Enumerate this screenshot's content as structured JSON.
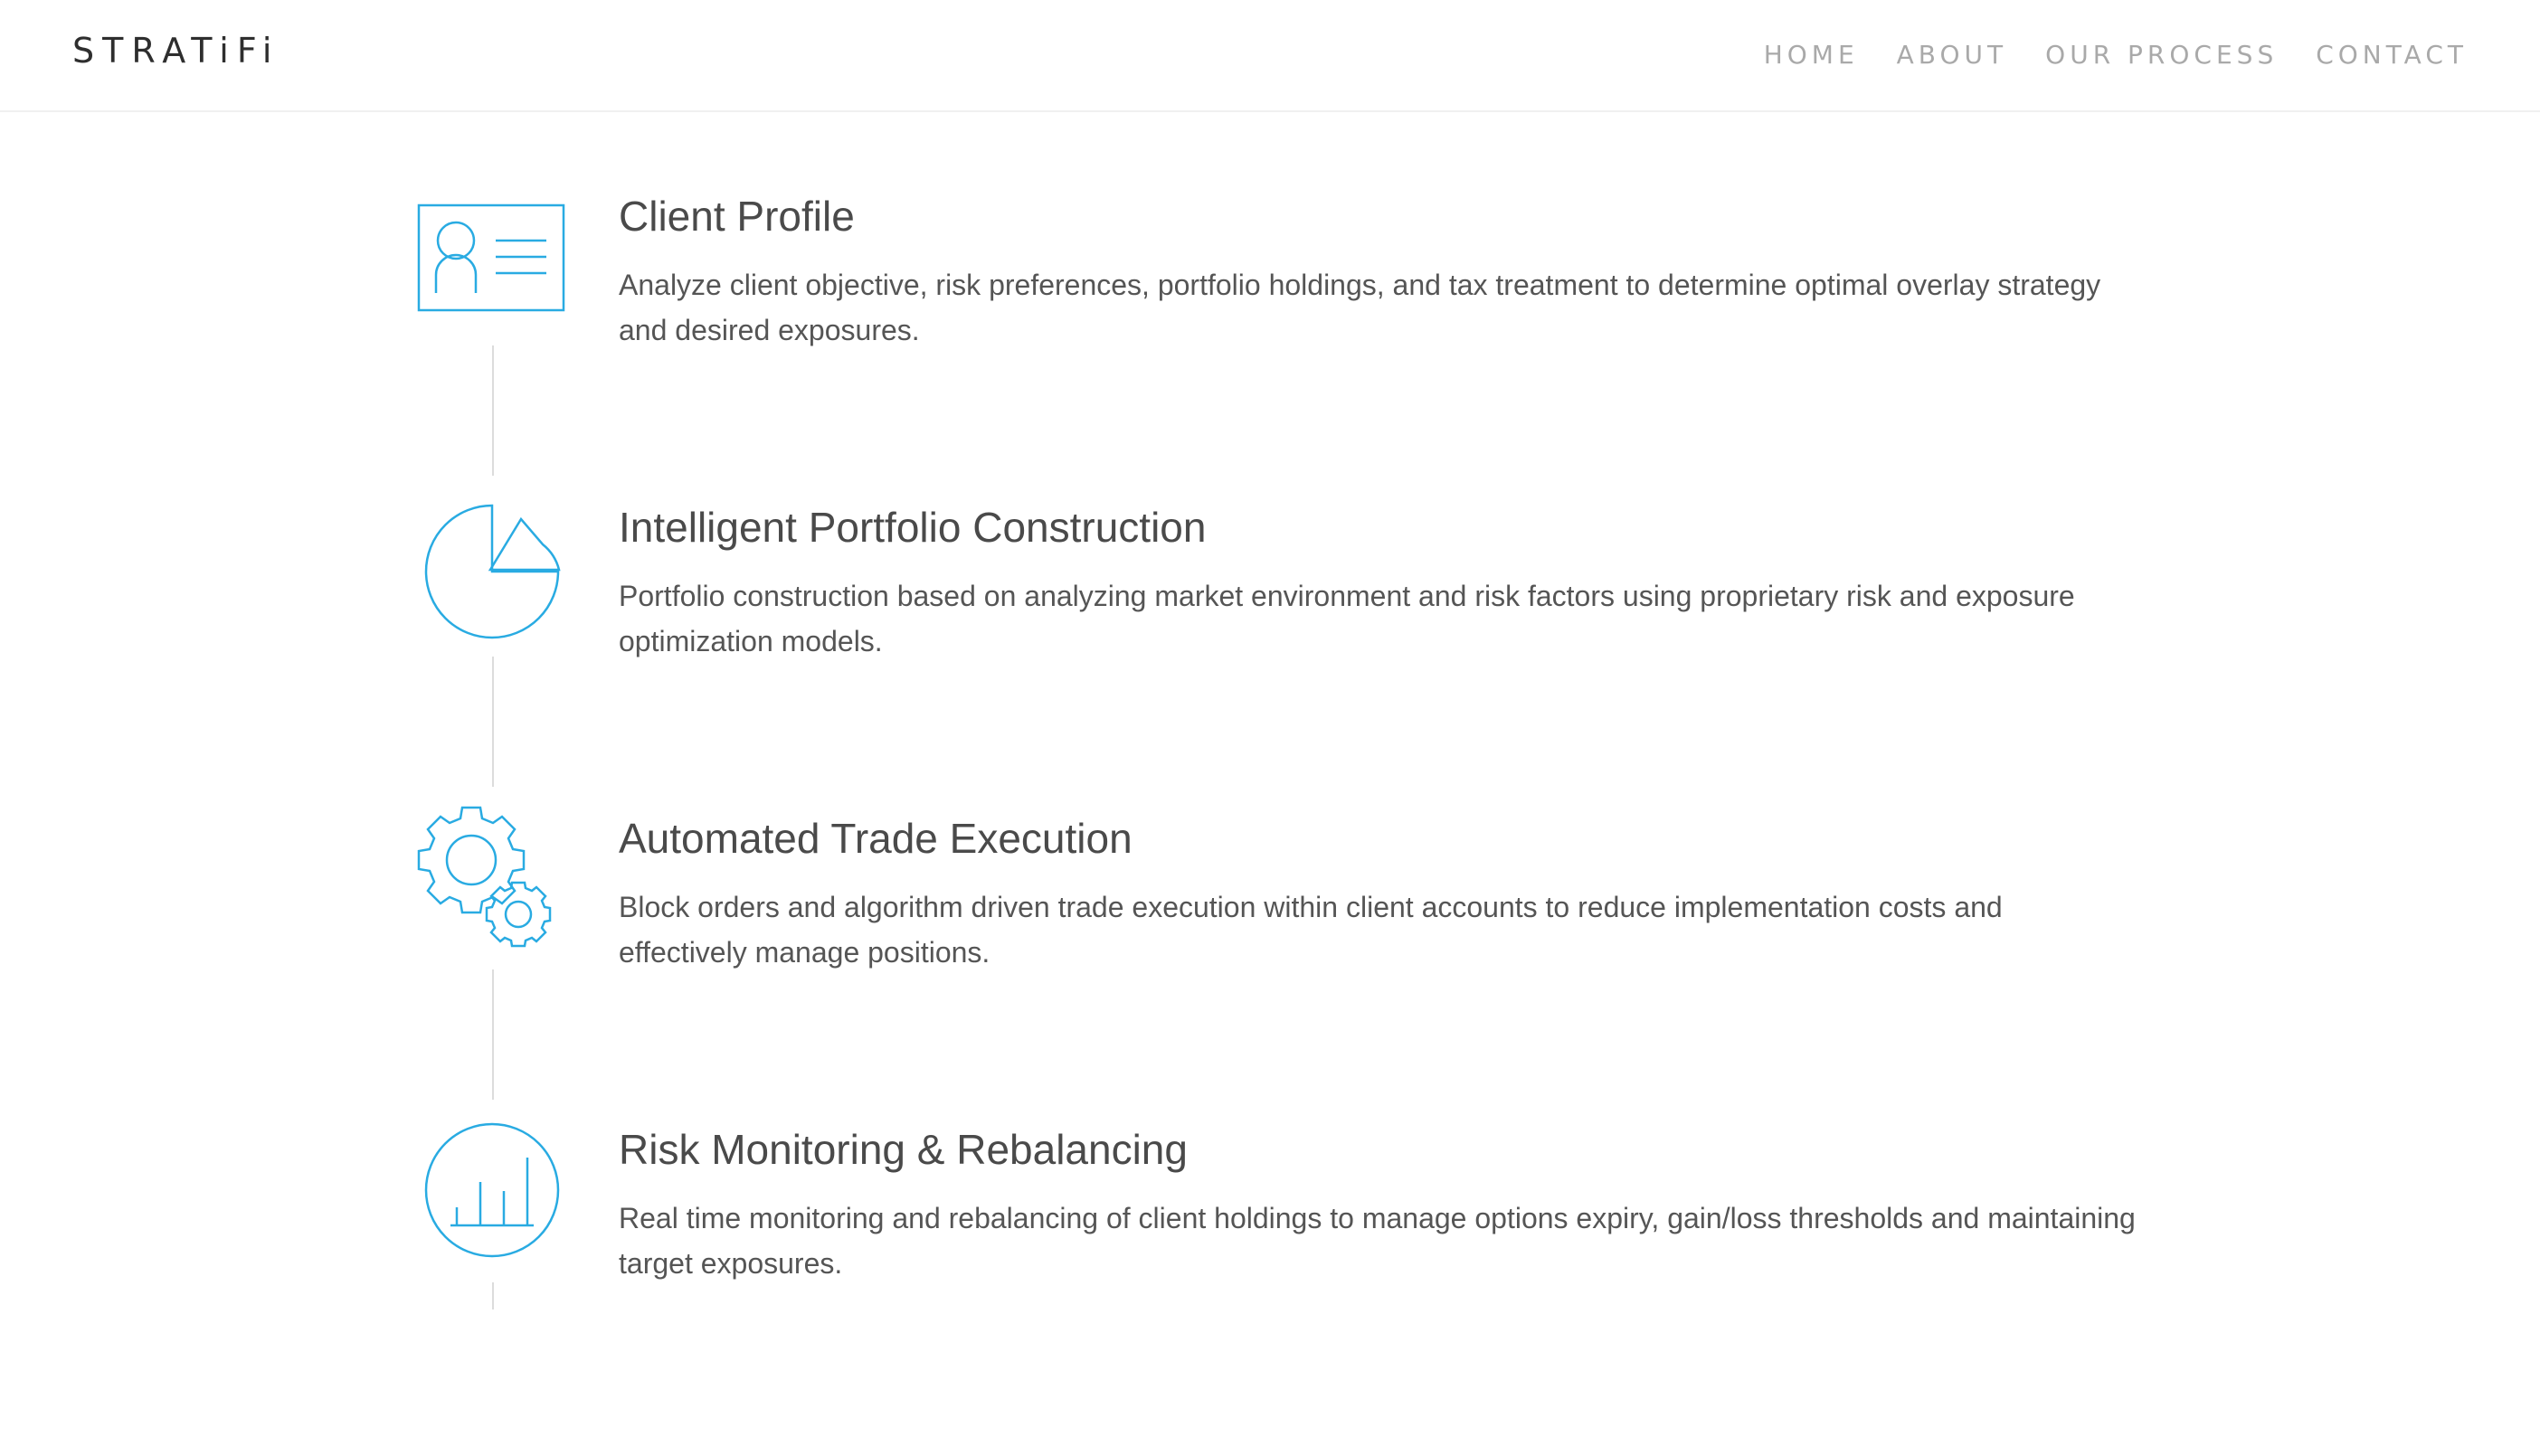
{
  "brand": {
    "logo": "STRATiFi"
  },
  "nav": {
    "items": [
      {
        "label": "HOME"
      },
      {
        "label": "ABOUT"
      },
      {
        "label": "OUR PROCESS"
      },
      {
        "label": "CONTACT"
      }
    ]
  },
  "colors": {
    "accent": "#29abe2",
    "text": "#4a4a4a",
    "nav": "#a9a9a9",
    "connector": "#dcdcdc"
  },
  "steps": [
    {
      "icon": "client-profile-card-icon",
      "title": "Client Profile",
      "description": "Analyze client objective, risk preferences, portfolio holdings, and tax treatment to determine optimal overlay strategy and desired exposures."
    },
    {
      "icon": "pie-chart-icon",
      "title": "Intelligent Portfolio Construction",
      "description": "Portfolio construction based on analyzing market environment and risk factors using proprietary risk and exposure optimization models."
    },
    {
      "icon": "gears-icon",
      "title": "Automated Trade Execution",
      "description": "Block orders and algorithm driven trade execution within client accounts to reduce implementation costs and effectively manage positions."
    },
    {
      "icon": "bar-chart-circle-icon",
      "title": "Risk Monitoring & Rebalancing",
      "description": "Real time monitoring and rebalancing of client holdings to manage options expiry, gain/loss thresholds and maintaining target exposures."
    }
  ]
}
